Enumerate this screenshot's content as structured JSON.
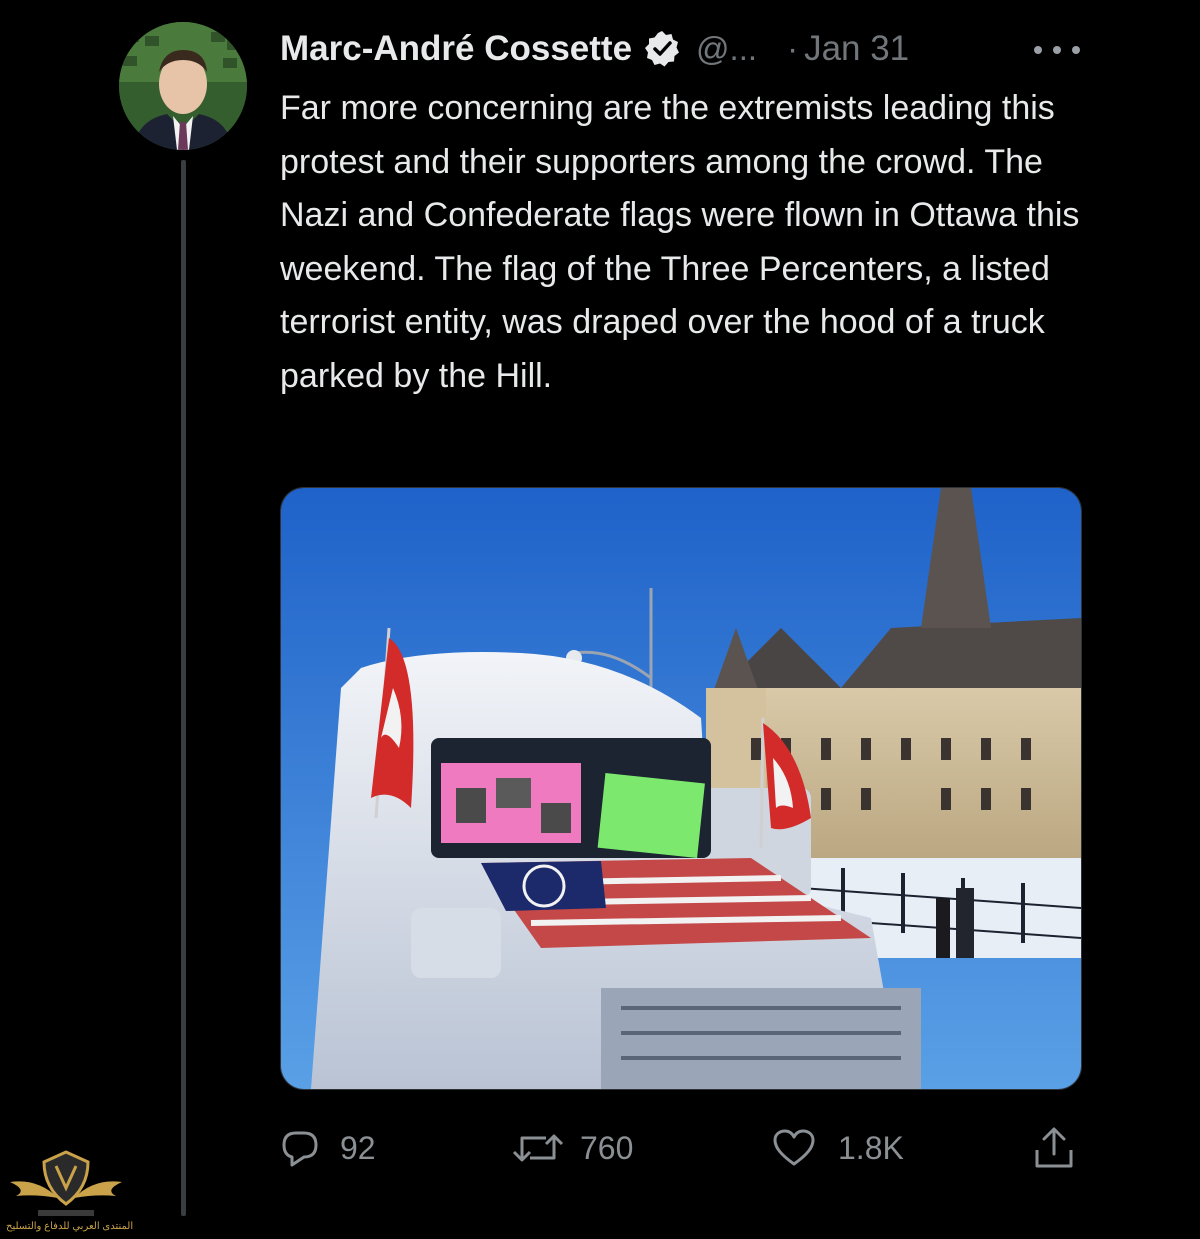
{
  "tweet": {
    "author_name": "Marc-André Cossette",
    "handle": "@...",
    "separator": "·",
    "date": "Jan 31",
    "text": "Far more concerning are the extremists leading this protest and their supporters among the crowd. The Nazi and Confederate flags were flown in Ottawa this weekend. The flag of the Three Percenters, a listed terrorist entity, was draped over the hood of a truck parked by the Hill."
  },
  "actions": {
    "reply_count": "92",
    "retweet_count": "760",
    "like_count": "1.8K"
  },
  "icons": {
    "verified": "verified-badge-icon",
    "more": "more-options-icon",
    "reply": "reply-icon",
    "retweet": "retweet-icon",
    "like": "heart-icon",
    "share": "share-icon"
  },
  "watermark": {
    "text": "المنتدى العربي للدفاع والتسليح"
  },
  "colors": {
    "background": "#000000",
    "text_primary": "#e7e9ea",
    "text_secondary": "#71767b",
    "thread_line": "#3a3d40"
  }
}
